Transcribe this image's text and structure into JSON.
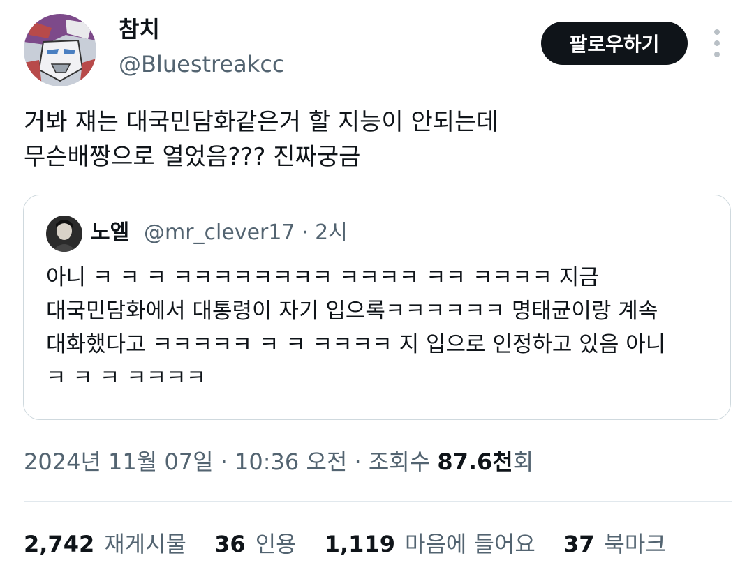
{
  "author": {
    "display_name": "참치",
    "handle": "@Bluestreakcc",
    "avatar_icon": "robot-avatar-icon"
  },
  "follow_button": {
    "label": "팔로우하기"
  },
  "more_icon": "more-vertical-icon",
  "tweet": {
    "text": "거봐 쟤는 대국민담화같은거 할 지능이 안되는데\n무슨배짱으로 열었음??? 진짜궁금"
  },
  "quoted": {
    "display_name": "노엘",
    "meta": "@mr_clever17 · 2시",
    "text": "아니 ㅋ ㅋ ㅋ ㅋㅋㅋㅋㅋㅋㅋㅋ ㅋㅋㅋㅋ ㅋㅋ ㅋㅋㅋㅋ 지금\n대국민담화에서 대통령이 자기 입으록ㅋㅋㅋㅋㅋㅋ 명태균이랑 계속\n대화했다고 ㅋㅋㅋㅋㅋ ㅋ ㅋ ㅋㅋㅋㅋ 지 입으로 인정하고 있음 아니\nㅋ ㅋ ㅋ ㅋㅋㅋㅋ"
  },
  "timestamp": {
    "date_time": "2024년 11월 07일 · 10:36 오전 · 조회수 ",
    "views_value": "87.6천",
    "views_suffix": "회"
  },
  "stats": [
    {
      "count": "2,742",
      "label": "재게시물"
    },
    {
      "count": "36",
      "label": "인용"
    },
    {
      "count": "1,119",
      "label": "마음에 들어요"
    },
    {
      "count": "37",
      "label": "북마크"
    }
  ],
  "colors": {
    "text": "#0f1419",
    "secondary": "#536471",
    "border": "#cfd9de",
    "button_bg": "#0f1419",
    "button_text": "#ffffff"
  }
}
